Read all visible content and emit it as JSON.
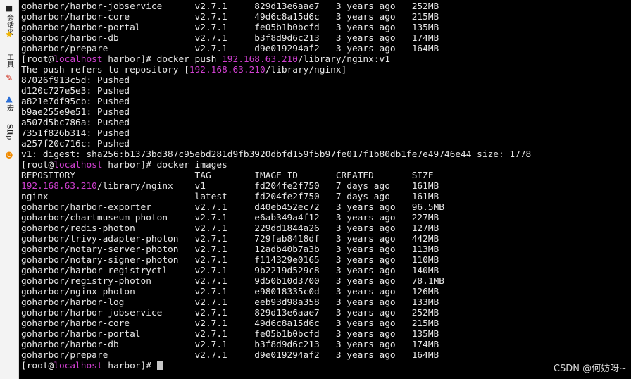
{
  "sidebar": {
    "items": [
      {
        "label": "会话夹",
        "icon": "folder-icon"
      },
      {
        "label": "",
        "icon": "star-icon"
      },
      {
        "label": "工具",
        "icon": "tools-icon"
      },
      {
        "label": "",
        "icon": "pen-icon"
      },
      {
        "label": "宏",
        "icon": "macro-icon"
      },
      {
        "label": "Sftp",
        "icon": "sftp-icon"
      },
      {
        "label": "",
        "icon": "emoji-icon"
      }
    ]
  },
  "terminal": {
    "prompt": {
      "user": "root",
      "host": "localhost",
      "dir": "harbor"
    },
    "lines": [
      [
        {
          "t": "goharbor/harbor-jobservice      v2.7.1     829d13e6aae7   3 years ago   252MB"
        }
      ],
      [
        {
          "t": "goharbor/harbor-core            v2.7.1     49d6c8a15d6c   3 years ago   215MB"
        }
      ],
      [
        {
          "t": "goharbor/harbor-portal          v2.7.1     fe05b1b0bcfd   3 years ago   135MB"
        }
      ],
      [
        {
          "t": "goharbor/harbor-db              v2.7.1     b3f8d9d6c213   3 years ago   174MB"
        }
      ],
      [
        {
          "t": "goharbor/prepare                v2.7.1     d9e019294af2   3 years ago   164MB"
        }
      ],
      [
        {
          "t": "[root@"
        },
        {
          "t": "localhost",
          "c": "hl"
        },
        {
          "t": " harbor]# docker push "
        },
        {
          "t": "192.168.63.210",
          "c": "hl"
        },
        {
          "t": "/library/nginx:v1"
        }
      ],
      [
        {
          "t": "The push refers to repository ["
        },
        {
          "t": "192.168.63.210",
          "c": "hl"
        },
        {
          "t": "/library/nginx]"
        }
      ],
      [
        {
          "t": "87026f913c5d: Pushed"
        }
      ],
      [
        {
          "t": "d120c727e5e3: Pushed"
        }
      ],
      [
        {
          "t": "a821e7df95cb: Pushed"
        }
      ],
      [
        {
          "t": "b9ae255e9e51: Pushed"
        }
      ],
      [
        {
          "t": "a507d5bc786a: Pushed"
        }
      ],
      [
        {
          "t": "7351f826b314: Pushed"
        }
      ],
      [
        {
          "t": "a257f20c716c: Pushed"
        }
      ],
      [
        {
          "t": "v1: digest: sha256:b1373bd387c95ebd281d9fb3920dbfd159f5b97fe017f1b80db1fe7e49746e44 size: 1778"
        }
      ],
      [
        {
          "t": "[root@"
        },
        {
          "t": "localhost",
          "c": "hl"
        },
        {
          "t": " harbor]# docker images"
        }
      ],
      [
        {
          "t": "REPOSITORY                      TAG        IMAGE ID       CREATED       SIZE"
        }
      ],
      [
        {
          "t": "192.168.63.210",
          "c": "hl"
        },
        {
          "t": "/library/nginx    v1         fd204fe2f750   7 days ago    161MB"
        }
      ],
      [
        {
          "t": "nginx                           latest     fd204fe2f750   7 days ago    161MB"
        }
      ],
      [
        {
          "t": "goharbor/harbor-exporter        v2.7.1     d40eb452ec72   3 years ago   96.5MB"
        }
      ],
      [
        {
          "t": "goharbor/chartmuseum-photon     v2.7.1     e6ab349a4f12   3 years ago   227MB"
        }
      ],
      [
        {
          "t": "goharbor/redis-photon           v2.7.1     229dd1844a26   3 years ago   127MB"
        }
      ],
      [
        {
          "t": "goharbor/trivy-adapter-photon   v2.7.1     729fab8418df   3 years ago   442MB"
        }
      ],
      [
        {
          "t": "goharbor/notary-server-photon   v2.7.1     12adb40b7a3b   3 years ago   113MB"
        }
      ],
      [
        {
          "t": "goharbor/notary-signer-photon   v2.7.1     f114329e0165   3 years ago   110MB"
        }
      ],
      [
        {
          "t": "goharbor/harbor-registryctl     v2.7.1     9b2219d529c8   3 years ago   140MB"
        }
      ],
      [
        {
          "t": "goharbor/registry-photon        v2.7.1     9d50b10d3700   3 years ago   78.1MB"
        }
      ],
      [
        {
          "t": "goharbor/nginx-photon           v2.7.1     e98018335c0d   3 years ago   126MB"
        }
      ],
      [
        {
          "t": "goharbor/harbor-log             v2.7.1     eeb93d98a358   3 years ago   133MB"
        }
      ],
      [
        {
          "t": "goharbor/harbor-jobservice      v2.7.1     829d13e6aae7   3 years ago   252MB"
        }
      ],
      [
        {
          "t": "goharbor/harbor-core            v2.7.1     49d6c8a15d6c   3 years ago   215MB"
        }
      ],
      [
        {
          "t": "goharbor/harbor-portal          v2.7.1     fe05b1b0bcfd   3 years ago   135MB"
        }
      ],
      [
        {
          "t": "goharbor/harbor-db              v2.7.1     b3f8d9d6c213   3 years ago   174MB"
        }
      ],
      [
        {
          "t": "goharbor/prepare                v2.7.1     d9e019294af2   3 years ago   164MB"
        }
      ],
      [
        {
          "t": "[root@"
        },
        {
          "t": "localhost",
          "c": "hl"
        },
        {
          "t": " harbor]# "
        },
        {
          "cursor": true
        }
      ]
    ]
  },
  "watermark": "CSDN @何妨呀~",
  "colors": {
    "background": "#000000",
    "foreground": "#e6e6e6",
    "highlight": "#d040d0"
  }
}
